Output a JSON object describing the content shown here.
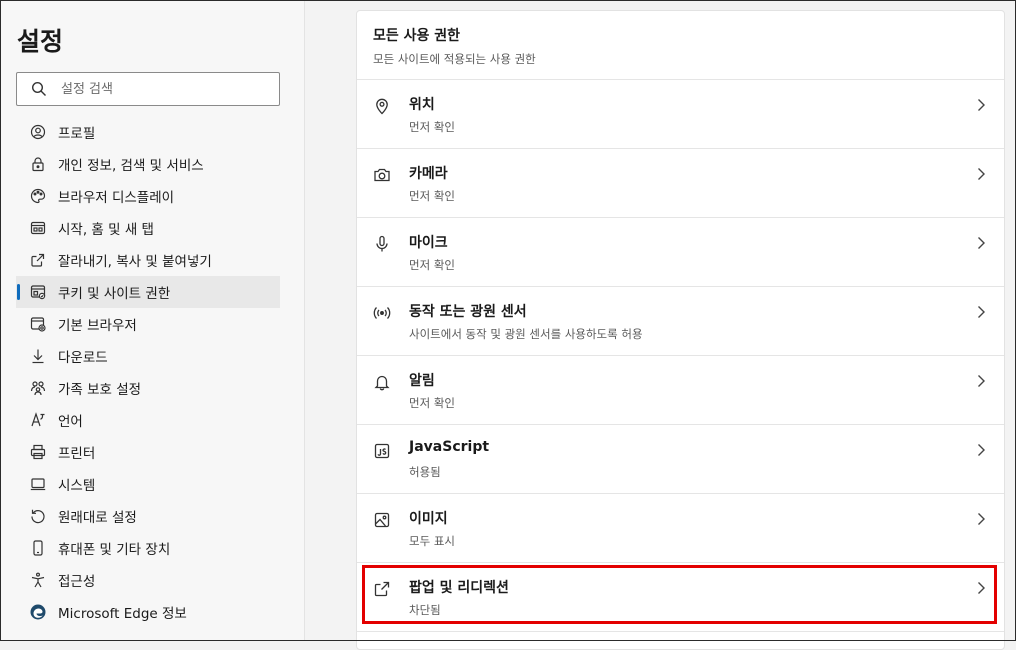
{
  "sidebar": {
    "title": "설정",
    "search": {
      "placeholder": "설정 검색"
    },
    "items": [
      {
        "label": "프로필",
        "icon": "profile-icon"
      },
      {
        "label": "개인 정보, 검색 및 서비스",
        "icon": "lock-icon"
      },
      {
        "label": "브라우저 디스플레이",
        "icon": "palette-icon"
      },
      {
        "label": "시작, 홈 및 새 탭",
        "icon": "home-tab-icon"
      },
      {
        "label": "잘라내기, 복사 및 붙여넣기",
        "icon": "share-icon"
      },
      {
        "label": "쿠키 및 사이트 권한",
        "icon": "site-permissions-icon",
        "active": true
      },
      {
        "label": "기본 브라우저",
        "icon": "default-browser-icon"
      },
      {
        "label": "다운로드",
        "icon": "download-icon"
      },
      {
        "label": "가족 보호 설정",
        "icon": "family-icon"
      },
      {
        "label": "언어",
        "icon": "language-icon"
      },
      {
        "label": "프린터",
        "icon": "printer-icon"
      },
      {
        "label": "시스템",
        "icon": "system-icon"
      },
      {
        "label": "원래대로 설정",
        "icon": "reset-icon"
      },
      {
        "label": "휴대폰 및 기타 장치",
        "icon": "phone-icon"
      },
      {
        "label": "접근성",
        "icon": "accessibility-icon"
      },
      {
        "label": "Microsoft Edge 정보",
        "icon": "edge-logo-icon"
      }
    ]
  },
  "main": {
    "card": {
      "title": "모든 사용 권한",
      "subtitle": "모든 사이트에 적용되는 사용 권한"
    },
    "permissions": [
      {
        "label": "위치",
        "desc": "먼저 확인",
        "icon": "location-icon"
      },
      {
        "label": "카메라",
        "desc": "먼저 확인",
        "icon": "camera-icon"
      },
      {
        "label": "마이크",
        "desc": "먼저 확인",
        "icon": "microphone-icon"
      },
      {
        "label": "동작 또는 광원 센서",
        "desc": "사이트에서 동작 및 광원 센서를 사용하도록 허용",
        "icon": "sensor-icon"
      },
      {
        "label": "알림",
        "desc": "먼저 확인",
        "icon": "bell-icon"
      },
      {
        "label": "JavaScript",
        "desc": "허용됨",
        "icon": "javascript-icon"
      },
      {
        "label": "이미지",
        "desc": "모두 표시",
        "icon": "image-icon"
      },
      {
        "label": "팝업 및 리디렉션",
        "desc": "차단됨",
        "icon": "popup-icon",
        "highlighted": true
      }
    ]
  },
  "colors": {
    "accent": "#0f6cbd",
    "highlight": "#e30000",
    "background": "#f3f3f3",
    "card": "#ffffff"
  }
}
